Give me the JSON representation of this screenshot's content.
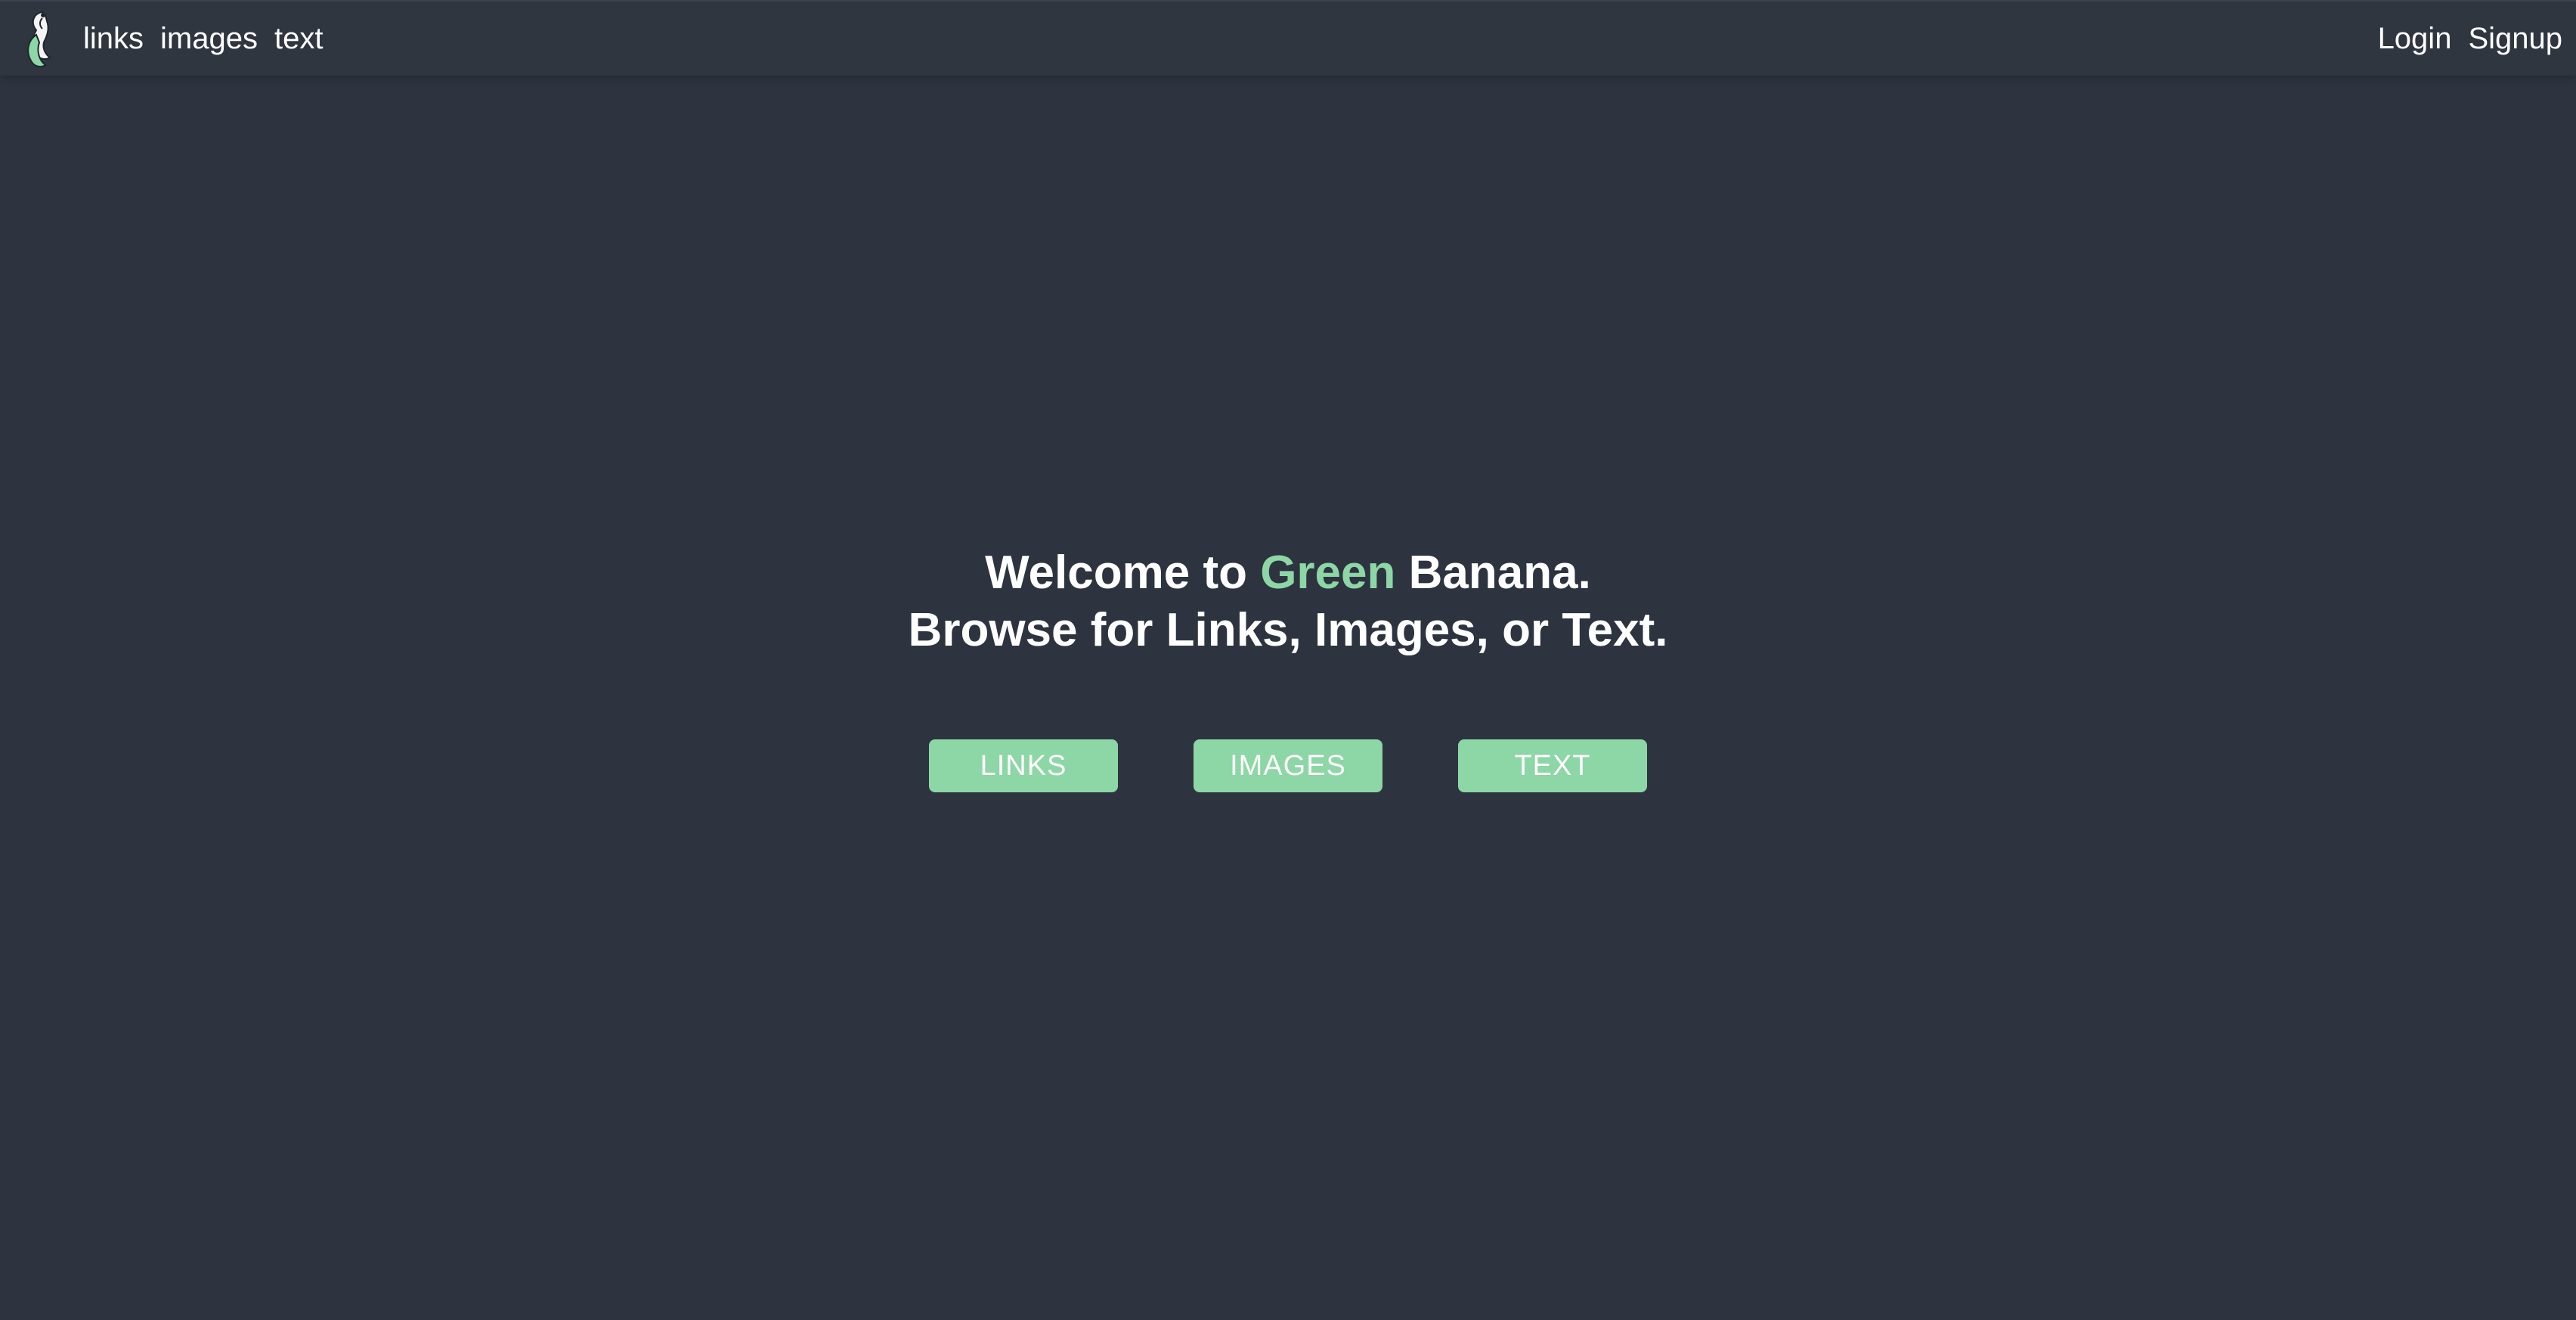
{
  "nav": {
    "logo_icon": "banana-logo-icon",
    "links": [
      "links",
      "images",
      "text"
    ],
    "auth": [
      "Login",
      "Signup"
    ]
  },
  "hero": {
    "line1_prefix": "Welcome to ",
    "line1_accent": "Green",
    "line1_suffix": " Banana.",
    "line2": "Browse for Links, Images, or Text."
  },
  "buttons": [
    "LINKS",
    "IMAGES",
    "TEXT"
  ],
  "colors": {
    "background": "#2d3440",
    "navbar": "#2f3640",
    "accent": "#8dd6a5",
    "text": "#ffffff"
  }
}
